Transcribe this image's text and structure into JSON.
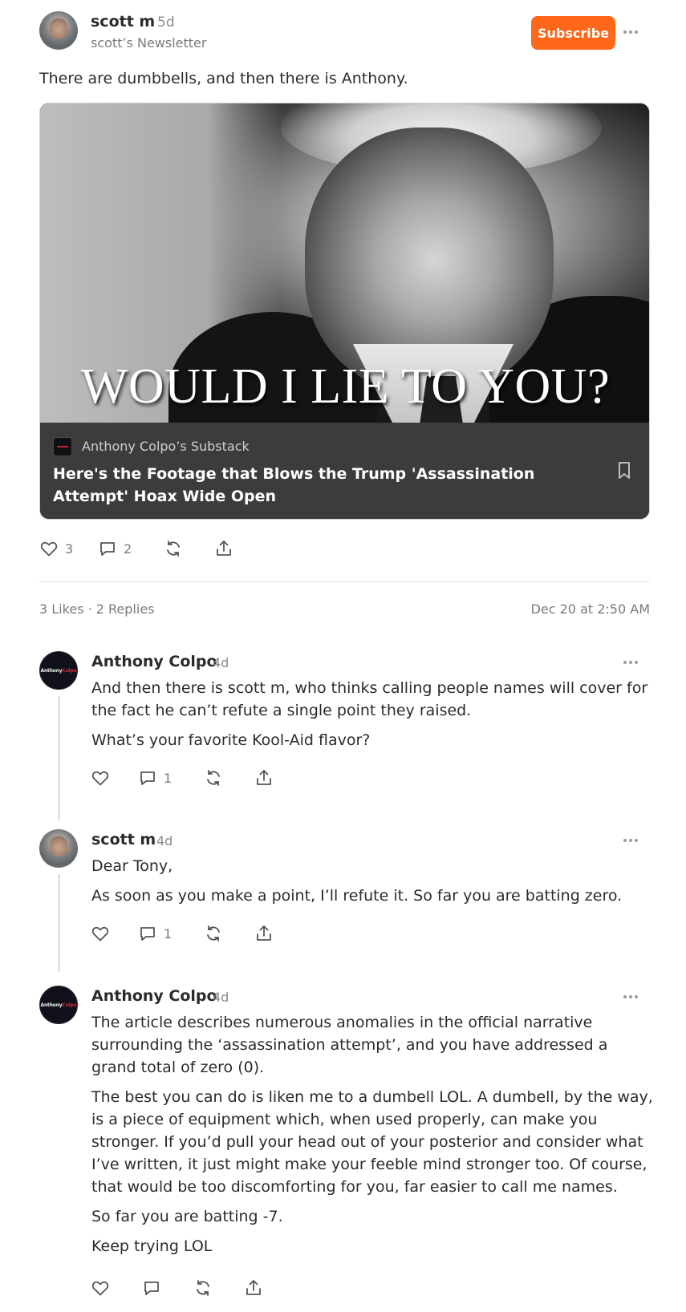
{
  "post": {
    "author": "scott m",
    "time": "5d",
    "newsletter": "scott’s Newsletter",
    "subscribe_label": "Subscribe",
    "text": "There are dumbbells, and then there is Anthony."
  },
  "card": {
    "image_overlay_text": "WOULD I LIE TO YOU?",
    "publication": "Anthony Colpo’s Substack",
    "title": "Here's the Footage that Blows the Trump 'Assassination Attempt' Hoax Wide Open"
  },
  "post_actions": {
    "likes": "3",
    "comments": "2"
  },
  "stats": {
    "summary": "3 Likes · 2 Replies",
    "date": "Dec 20 at 2:50 AM"
  },
  "comments": [
    {
      "author": "Anthony Colpo",
      "time": "4d",
      "avatar_text": "AnthonyColpo",
      "paragraphs": [
        "And then there is scott m, who thinks calling people names will cover for the fact he can’t refute a single point they raised.",
        "What’s your favorite Kool-Aid flavor?"
      ],
      "comment_count": "1"
    },
    {
      "author": "scott m",
      "time": "4d",
      "paragraphs": [
        "Dear Tony,",
        "As soon as you make a point, I’ll refute it. So far you are batting zero."
      ],
      "comment_count": "1"
    },
    {
      "author": "Anthony Colpo",
      "time": "4d",
      "avatar_text": "AnthonyColpo",
      "paragraphs": [
        "The article describes numerous anomalies in the official narrative surrounding the ‘assassination attempt’, and you have addressed a grand total of zero (0).",
        "The best you can do is liken me to a dumbell LOL. A dumbell, by the way, is a piece of equipment which, when used properly, can make you stronger. If you’d pull your head out of your posterior and consider what I’ve written, it just might make your feeble mind stronger too. Of course, that would be too discomforting for you, far easier to call me names.",
        "So far you are batting -7.",
        "Keep trying LOL"
      ]
    }
  ],
  "icons": [
    "heart-icon",
    "comment-icon",
    "restack-icon",
    "share-icon",
    "bookmark-icon",
    "more-icon"
  ],
  "colors": {
    "accent": "#ff6719",
    "text": "#2b2b2b",
    "muted": "#7a7a7a",
    "card_footer": "#3c3c3c"
  }
}
